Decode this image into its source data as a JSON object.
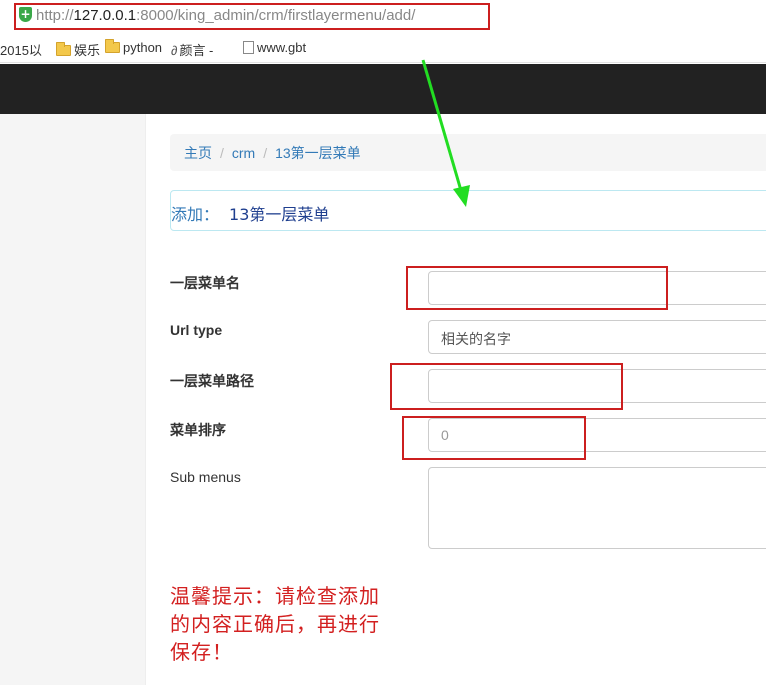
{
  "browser": {
    "url_prefix": "http://",
    "url_host": "127.0.0.1",
    "url_rest": ":8000/king_admin/crm/firstlayermenu/add/",
    "favicon_glyph": "+",
    "bookmarks": [
      {
        "label": "2015以",
        "icon": ""
      },
      {
        "label": "娱乐",
        "icon": "folder-icon"
      },
      {
        "label": "python",
        "icon": "folder-icon"
      },
      {
        "label": "颜言 -",
        "icon": "alpha-icon"
      },
      {
        "label": "www.gbt",
        "icon": "page-icon"
      }
    ]
  },
  "breadcrumb": {
    "items": [
      "主页",
      "crm",
      "13第一层菜单"
    ],
    "separator": "/"
  },
  "form": {
    "heading_prefix": "添加：",
    "heading_model": "13第一层菜单",
    "fields": [
      {
        "label": "一层菜单名",
        "value": "",
        "required": true
      },
      {
        "label": "Url type",
        "value": "相关的名字",
        "required": true
      },
      {
        "label": "一层菜单路径",
        "value": "",
        "required": true
      },
      {
        "label": "菜单排序",
        "value": "0",
        "required": true
      },
      {
        "label": "Sub menus",
        "value": "",
        "required": false
      }
    ]
  },
  "annotation": {
    "tip": "温馨提示：请检查添加的内容正确后，再进行保存！",
    "box_color": "#cc1f1f",
    "arrow_color": "#22dd22"
  },
  "colors": {
    "topbar": "#222222",
    "link": "#337ab7"
  }
}
